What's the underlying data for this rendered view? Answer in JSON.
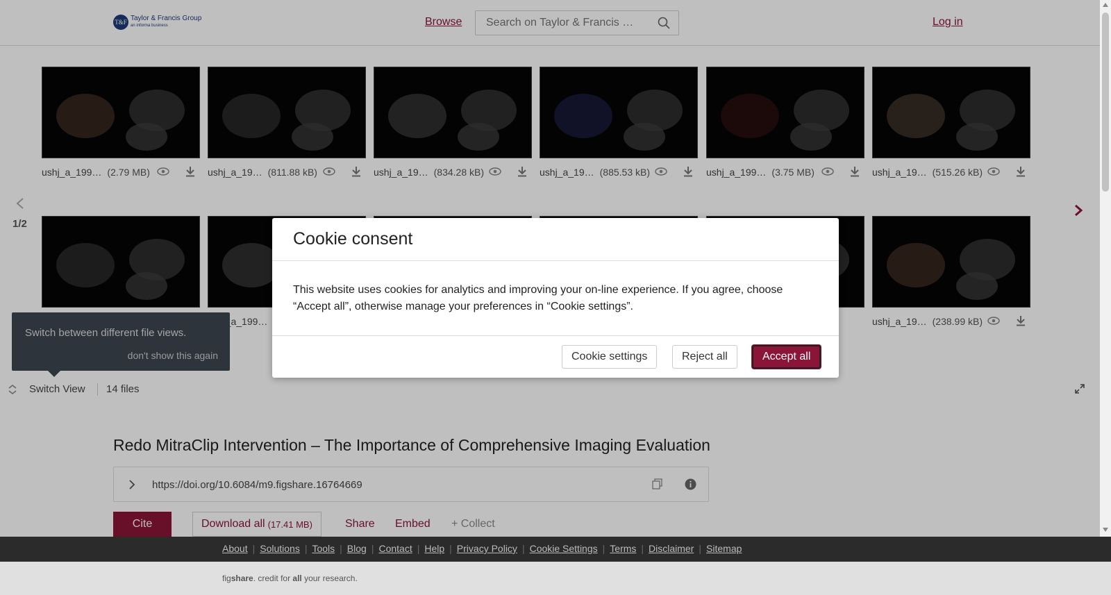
{
  "header": {
    "logo_line1": "Taylor & Francis Group",
    "logo_line2": "an informa business",
    "browse": "Browse",
    "search_placeholder": "Search on Taylor & Francis …",
    "login": "Log in"
  },
  "gallery": {
    "page_indicator": "1/2",
    "thumbnails_row1": [
      {
        "name": "ushj_a_199…",
        "size": "(2.79 MB)"
      },
      {
        "name": "ushj_a_19…",
        "size": "(811.88 kB)"
      },
      {
        "name": "ushj_a_19…",
        "size": "(834.28 kB)"
      },
      {
        "name": "ushj_a_19…",
        "size": "(885.53 kB)"
      },
      {
        "name": "ushj_a_199…",
        "size": "(3.75 MB)"
      },
      {
        "name": "ushj_a_19…",
        "size": "(515.26 kB)"
      }
    ],
    "thumbnails_row2": [
      {
        "name": "",
        "size": ""
      },
      {
        "name": "ushj_a_199…",
        "size": ""
      },
      {
        "name": "",
        "size": ""
      },
      {
        "name": "",
        "size": ""
      },
      {
        "name": "",
        "size": ""
      },
      {
        "name": "ushj_a_19…",
        "size": "(238.99 kB)"
      }
    ],
    "tooltip": {
      "text": "Switch between different file views.",
      "dismiss": "don't show this again"
    },
    "switch_view": "Switch View",
    "file_count": "14 files"
  },
  "article": {
    "title": "Redo MitraClip Intervention – The Importance of Comprehensive Imaging Evaluation",
    "doi": "https://doi.org/10.6084/m9.figshare.16764669",
    "cite": "Cite",
    "download_all": "Download all",
    "download_size": "(17.41 MB)",
    "share": "Share",
    "embed": "Embed",
    "collect": "+ Collect"
  },
  "modal": {
    "title": "Cookie consent",
    "body": "This website uses cookies for analytics and improving your on-line experience. If you agree, choose “Accept all”, otherwise manage your preferences in “Cookie settings”.",
    "cookie_settings": "Cookie settings",
    "reject_all": "Reject all",
    "accept_all": "Accept all"
  },
  "footer": {
    "links": [
      "About",
      "Solutions",
      "Tools",
      "Blog",
      "Contact",
      "Help",
      "Privacy Policy",
      "Cookie Settings",
      "Terms",
      "Disclaimer",
      "Sitemap"
    ],
    "tagline_brand_a": "fig",
    "tagline_brand_b": "share",
    "tagline_mid": ". credit for ",
    "tagline_all": "all",
    "tagline_end": " your research."
  },
  "colors": {
    "accent": "#8b1538",
    "footer_dark": "#2b2b2b",
    "tooltip_bg": "#3d4650"
  }
}
